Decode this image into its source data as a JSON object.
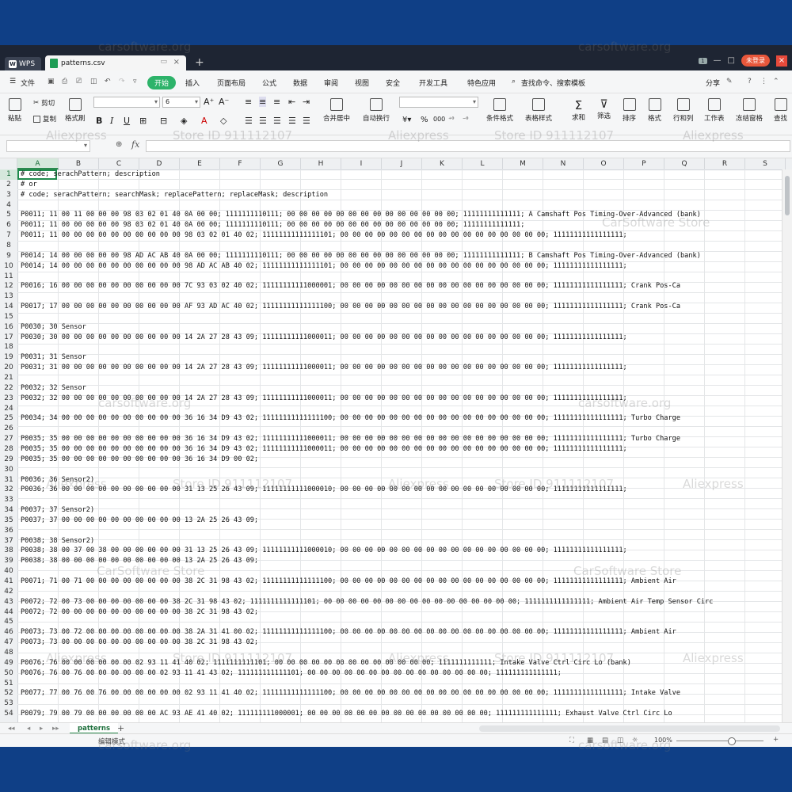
{
  "titlebar": {
    "app_tab": "WPS",
    "doc_tab": "patterns.csv",
    "login": "未登录"
  },
  "menu": {
    "file": "文件",
    "start": "开始",
    "items": [
      "插入",
      "页面布局",
      "公式",
      "数据",
      "审阅",
      "视图",
      "安全",
      "开发工具",
      "特色应用"
    ],
    "search": "查找命令、搜索模板",
    "share": "分享"
  },
  "ribbon": {
    "paste": "粘贴",
    "cut": "剪切",
    "copy": "复制",
    "format_painter": "格式刷",
    "font_size": "6",
    "merge_center": "合并居中",
    "auto_wrap": "自动换行",
    "cond_format": "条件格式",
    "table_style": "表格样式",
    "sum": "求和",
    "filter": "筛选",
    "sort": "排序",
    "format": "格式",
    "row_col": "行和列",
    "worksheet": "工作表",
    "freeze": "冻结窗格",
    "find": "查找"
  },
  "columns": [
    "A",
    "B",
    "C",
    "D",
    "E",
    "F",
    "G",
    "H",
    "I",
    "J",
    "K",
    "L",
    "M",
    "N",
    "O",
    "P",
    "Q",
    "R",
    "S"
  ],
  "rows": [
    {
      "n": "1",
      "text": "# code; serachPattern; description"
    },
    {
      "n": "2",
      "text": "# or"
    },
    {
      "n": "3",
      "text": "# code; serachPattern; searchMask; replacePattern; replaceMask; description"
    },
    {
      "n": "4",
      "text": ""
    },
    {
      "n": "5",
      "text": "P0011; 11 00 11 00 00 00 98 03 02 01 40 0A 00 00; 1111111110111; 00 00 00 00 00 00 00 00 00 00 00 00 00 00; 11111111111111; A Camshaft Pos Timing-Over-Advanced (bank)"
    },
    {
      "n": "6",
      "text": "P0011; 11 00 00 00 00 00 98 03 02 01 40 0A 00 00; 1111111110111; 00 00 00 00 00 00 00 00 00 00 00 00 00 00; 11111111111111;"
    },
    {
      "n": "7",
      "text": "P0011; 11 00 00 00 00 00 00 00 00 00 00 98 03 02 01 40 02; 11111111111111101; 00 00 00 00 00 00 00 00 00 00 00 00 00 00 00 00 00; 11111111111111111;"
    },
    {
      "n": "8",
      "text": ""
    },
    {
      "n": "9",
      "text": "P0014; 14 00 00 00 00 00 98 AD AC AB 40 0A 00 00; 1111111110111; 00 00 00 00 00 00 00 00 00 00 00 00 00 00; 11111111111111; B Camshaft Pos Timing-Over-Advanced (bank)"
    },
    {
      "n": "10",
      "text": "P0014; 14 00 00 00 00 00 00 00 00 00 00 98 AD AC AB 40 02; 11111111111111101; 00 00 00 00 00 00 00 00 00 00 00 00 00 00 00 00 00; 11111111111111111;"
    },
    {
      "n": "11",
      "text": ""
    },
    {
      "n": "12",
      "text": "P0016; 16 00 00 00 00 00 00 00 00 00 00 7C 93 03 02 40 02; 11111111111000001; 00 00 00 00 00 00 00 00 00 00 00 00 00 00 00 00 00; 11111111111111111; Crank Pos-Ca"
    },
    {
      "n": "13",
      "text": ""
    },
    {
      "n": "14",
      "text": "P0017; 17 00 00 00 00 00 00 00 00 00 00 AF 93 AD AC 40 02; 11111111111111100; 00 00 00 00 00 00 00 00 00 00 00 00 00 00 00 00 00; 11111111111111111; Crank Pos-Ca"
    },
    {
      "n": "15",
      "text": ""
    },
    {
      "n": "16",
      "text": "P0030; 30 Sensor"
    },
    {
      "n": "17",
      "text": "P0030; 30 00 00 00 00 00 00 00 00 00 00 14 2A 27 28 43 09; 11111111111000011; 00 00 00 00 00 00 00 00 00 00 00 00 00 00 00 00 00; 11111111111111111;"
    },
    {
      "n": "18",
      "text": ""
    },
    {
      "n": "19",
      "text": "P0031; 31 Sensor"
    },
    {
      "n": "20",
      "text": "P0031; 31 00 00 00 00 00 00 00 00 00 00 14 2A 27 28 43 09; 11111111111000011; 00 00 00 00 00 00 00 00 00 00 00 00 00 00 00 00 00; 11111111111111111;"
    },
    {
      "n": "21",
      "text": ""
    },
    {
      "n": "22",
      "text": "P0032; 32 Sensor"
    },
    {
      "n": "23",
      "text": "P0032; 32 00 00 00 00 00 00 00 00 00 00 14 2A 27 28 43 09; 11111111111000011; 00 00 00 00 00 00 00 00 00 00 00 00 00 00 00 00 00; 11111111111111111;"
    },
    {
      "n": "24",
      "text": ""
    },
    {
      "n": "25",
      "text": "P0034; 34 00 00 00 00 00 00 00 00 00 00 36 16 34 D9 43 02; 11111111111111100; 00 00 00 00 00 00 00 00 00 00 00 00 00 00 00 00 00; 11111111111111111; Turbo Charge"
    },
    {
      "n": "26",
      "text": ""
    },
    {
      "n": "27",
      "text": "P0035; 35 00 00 00 00 00 00 00 00 00 00 36 16 34 D9 43 02; 11111111111000011; 00 00 00 00 00 00 00 00 00 00 00 00 00 00 00 00 00; 11111111111111111; Turbo Charge"
    },
    {
      "n": "28",
      "text": "P0035; 35 00 00 00 00 00 00 00 00 00 00 36 16 34 D9 43 02; 11111111111000011; 00 00 00 00 00 00 00 00 00 00 00 00 00 00 00 00 00; 11111111111111111;"
    },
    {
      "n": "29",
      "text": "P0035; 35 00 00 00 00 00 00 00 00 00 00 36 16 34 D9 00 02;"
    },
    {
      "n": "30",
      "text": ""
    },
    {
      "n": "31",
      "text": "P0036; 36 Sensor2)"
    },
    {
      "n": "32",
      "text": "P0036; 36 00 00 00 00 00 00 00 00 00 00 31 13 25 26 43 09; 11111111111000010; 00 00 00 00 00 00 00 00 00 00 00 00 00 00 00 00 00; 11111111111111111;"
    },
    {
      "n": "33",
      "text": ""
    },
    {
      "n": "34",
      "text": "P0037; 37 Sensor2)"
    },
    {
      "n": "35",
      "text": "P0037; 37 00 00 00 00 00 00 00 00 00 00 13 2A 25 26 43 09;"
    },
    {
      "n": "36",
      "text": ""
    },
    {
      "n": "37",
      "text": "P0038; 38 Sensor2)"
    },
    {
      "n": "38",
      "text": "P0038; 38 00 37 00 38 00 00 00 00 00 00 31 13 25 26 43 09; 11111111111000010; 00 00 00 00 00 00 00 00 00 00 00 00 00 00 00 00 00; 11111111111111111;"
    },
    {
      "n": "39",
      "text": "P0038; 38 00 00 00 00 00 00 00 00 00 00 13 2A 25 26 43 09;"
    },
    {
      "n": "40",
      "text": ""
    },
    {
      "n": "41",
      "text": "P0071; 71 00 71 00 00 00 00 00 00 00 00 38 2C 31 98 43 02; 11111111111111100; 00 00 00 00 00 00 00 00 00 00 00 00 00 00 00 00 00; 11111111111111111; Ambient Air"
    },
    {
      "n": "42",
      "text": ""
    },
    {
      "n": "43",
      "text": "P0072; 72 00 73 00 00 00 00 00 00 00 38 2C 31 98 43 02; 1111111111111101; 00 00 00 00 00 00 00 00 00 00 00 00 00 00 00 00; 1111111111111111; Ambient Air Temp Sensor Circ"
    },
    {
      "n": "44",
      "text": "P0072; 72 00 00 00 00 00 00 00 00 00 00 38 2C 31 98 43 02;"
    },
    {
      "n": "45",
      "text": ""
    },
    {
      "n": "46",
      "text": "P0073; 73 00 72 00 00 00 00 00 00 00 00 38 2A 31 41 00 02; 11111111111111100; 00 00 00 00 00 00 00 00 00 00 00 00 00 00 00 00 00; 11111111111111111; Ambient Air"
    },
    {
      "n": "47",
      "text": "P0073; 73 00 00 00 00 00 00 00 00 00 00 38 2C 31 98 43 02;"
    },
    {
      "n": "48",
      "text": ""
    },
    {
      "n": "49",
      "text": "P0076; 76 00 00 00 00 00 00 02 93 11 41 40 02; 1111111111101; 00 00 00 00 00 00 00 00 00 00 00 00 00; 1111111111111; Intake Valve Ctrl Circ Lo (bank)"
    },
    {
      "n": "50",
      "text": "P0076; 76 00 76 00 00 00 00 00 00 02 93 11 41 43 02; 111111111111101; 00 00 00 00 00 00 00 00 00 00 00 00 00 00 00; 111111111111111;"
    },
    {
      "n": "51",
      "text": ""
    },
    {
      "n": "52",
      "text": "P0077; 77 00 76 00 76 00 00 00 00 00 00 02 93 11 41 40 02; 11111111111111100; 00 00 00 00 00 00 00 00 00 00 00 00 00 00 00 00 00; 11111111111111111; Intake Valve"
    },
    {
      "n": "53",
      "text": ""
    },
    {
      "n": "54",
      "text": "P0079; 79 00 79 00 00 00 00 00 00 AC 93 AE 41 40 02; 111111111000001; 00 00 00 00 00 00 00 00 00 00 00 00 00 00 00; 111111111111111; Exhaust Valve Ctrl Circ Lo"
    }
  ],
  "sheet_tab": "patterns",
  "status": {
    "mode": "编辑模式",
    "zoom": "100%"
  },
  "watermarks": [
    "carsoftware.org",
    "carsoftware.org",
    "Aliexpress",
    "Store ID 911112107",
    "Aliexpress",
    "Store ID 911112107",
    "Aliexpress",
    "CarSoftware Store",
    "carsoftware.org",
    "carsoftware.org",
    "Aliexpress",
    "Store ID 911112107",
    "Aliexpress",
    "Store ID 911112107",
    "Aliexpress",
    "CarSoftware Store",
    "CarSoftware Store",
    "Aliexpress",
    "Store ID 911112107",
    "Aliexpress",
    "Store ID 911112107",
    "Aliexpress",
    "carsoftware.org",
    "carsoftware.org"
  ],
  "colors": {
    "accent": "#2db36a",
    "selection": "#1f8a4c",
    "frame": "#0f3f86"
  }
}
